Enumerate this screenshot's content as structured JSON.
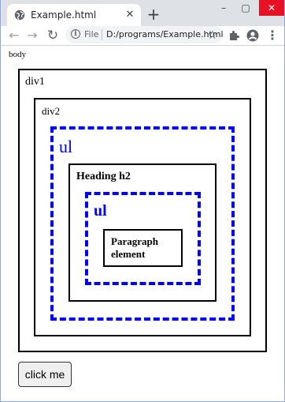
{
  "browser": {
    "tab_title": "Example.html",
    "tab_icon": "globe-icon",
    "new_tab_label": "+",
    "window_controls": [
      "–",
      "▢",
      "✕"
    ],
    "address": {
      "scheme_label": "File",
      "url": "D:/programs/Example.html"
    }
  },
  "page": {
    "body_label": "body",
    "div1_label": "div1",
    "div2_label": "div2",
    "ul1_label": "ul",
    "h2_label": "Heading h2",
    "ul2_label": "ul",
    "p_label": "Paragraph element",
    "button_label": "click me"
  },
  "colors": {
    "list_border": "#0000ff",
    "box_border": "#000000",
    "window_frame": "#8fa6e8"
  }
}
